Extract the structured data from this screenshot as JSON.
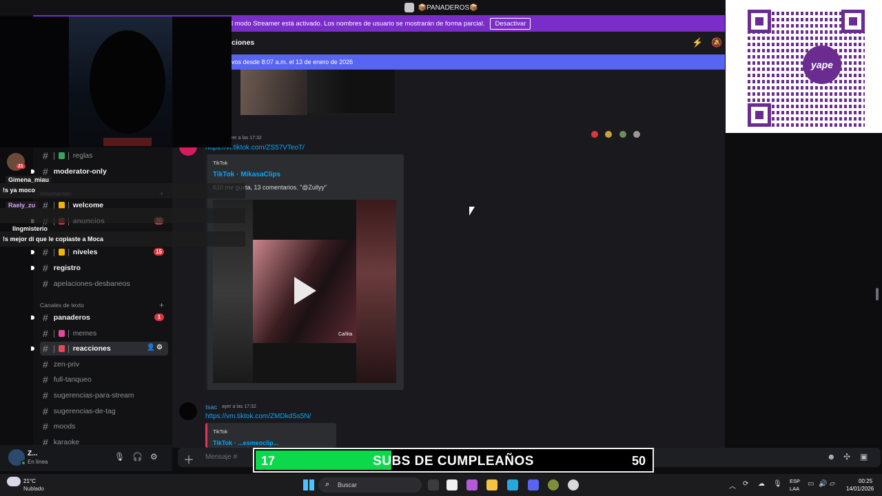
{
  "window": {
    "title": "📦PANADEROS📦"
  },
  "streamer_banner": {
    "text": "El modo Streamer está activado. Los nombres de usuario se mostrarán de forma parcial.",
    "button": "Desactivar"
  },
  "sidebar": {
    "channels": [
      {
        "name": "reglas",
        "emoji": true,
        "emoji_color": "#3ba55c"
      },
      {
        "name": "moderator-only",
        "unread": true
      },
      {
        "name": "welcome",
        "emoji": true,
        "unread": true
      },
      {
        "name": "anuncios",
        "emoji": true,
        "unread": true,
        "badge": "20",
        "emoji_color": "#da373c"
      },
      {
        "name": "niveles",
        "emoji": true,
        "unread": true,
        "badge": "15"
      },
      {
        "name": "registro",
        "unread": true
      },
      {
        "name": "apelaciones-desbaneos"
      },
      {
        "name": "panaderos",
        "unread": true,
        "badge": "1"
      },
      {
        "name": "memes",
        "emoji": true,
        "emoji_color": "#e8469a"
      },
      {
        "name": "reacciones",
        "emoji": true,
        "active": true,
        "unread": true,
        "emoji_color": "#e84856"
      },
      {
        "name": "zen-priv"
      },
      {
        "name": "full-tanqueo"
      },
      {
        "name": "sugerencias-para-stream"
      },
      {
        "name": "sugerencias-de-tag"
      },
      {
        "name": "moods"
      },
      {
        "name": "karaoke"
      }
    ],
    "categories": {
      "info": "Información",
      "text": "Canales de texto"
    }
  },
  "user_panel": {
    "name": "Z...",
    "status": "En línea"
  },
  "chat": {
    "header_title": "ciones",
    "new_messages_bar": "vos desde 8:07 a.m. el 13 de enero de 2026",
    "msg1": {
      "timestamp": "ayer a las 17:32",
      "link": "https://vt.tiktok.com/ZS57VTeoT/",
      "embed": {
        "provider": "TikTok",
        "title": "TikTok · MikasaClips",
        "description": "610 me gusta, 13 comentarios. \"@Zullyy\"",
        "watermark": "Cañita"
      }
    },
    "msg2": {
      "username": "Isac",
      "timestamp": "ayer a las 17:32",
      "link": "https://vm.tiktok.com/ZMDkdSs5N/",
      "embed": {
        "provider": "TikTok",
        "title": "TikTok · ...esmeoclip..."
      }
    },
    "input_placeholder": "Mensaje #"
  },
  "subs_bar": {
    "current": "17",
    "label": "SUBS DE CUMPLEAÑOS",
    "goal": "50",
    "progress": 0.34
  },
  "stream_chat": [
    {
      "user": "Gimena_miau",
      "message": "!s ya moco"
    },
    {
      "user": "Raely_zu",
      "message": ""
    },
    {
      "user": "Ilngmisterio",
      "message": "!s mejor di que le copiaste a Moca"
    }
  ],
  "avatar_badge": "21",
  "qr": {
    "logo": "yape"
  },
  "taskbar": {
    "temp": "21°C",
    "condition": "Nublado",
    "search": "Buscar",
    "lang1": "ESP",
    "lang2": "LAA",
    "time": "00:25",
    "date": "14/01/2026"
  }
}
